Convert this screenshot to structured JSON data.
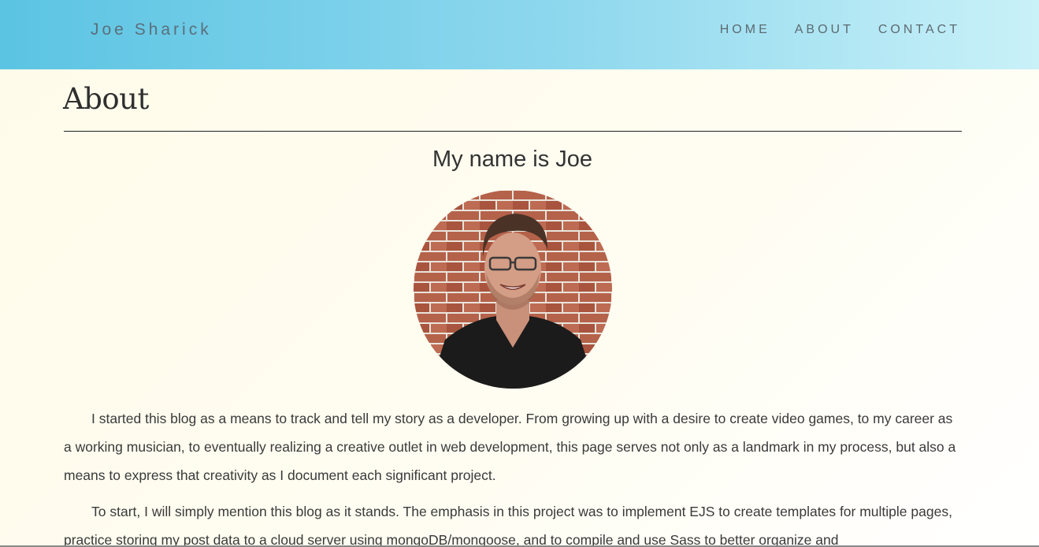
{
  "nav": {
    "brand": "Joe Sharick",
    "links": [
      {
        "label": "HOME"
      },
      {
        "label": "ABOUT"
      },
      {
        "label": "CONTACT"
      }
    ]
  },
  "page": {
    "title": "About",
    "subtitle": "My name is Joe",
    "paragraphs": [
      "I started this blog as a means to track and tell my story as a developer. From growing up with a desire to create video games, to my career as a working musician, to eventually realizing a creative outlet in web development, this page serves not only as a landmark in my process, but also a means to express that creativity as I document each significant project.",
      "To start, I will simply mention this blog as it stands. The emphasis in this project was to implement EJS to create templates for multiple pages, practice storing my post data to a cloud server using mongoDB/mongoose, and to compile and use Sass to better organize and"
    ]
  },
  "colors": {
    "navbar_start": "#5bc4e3",
    "navbar_end": "#c9f1f8",
    "background": "#fffbea",
    "text": "#333333"
  }
}
